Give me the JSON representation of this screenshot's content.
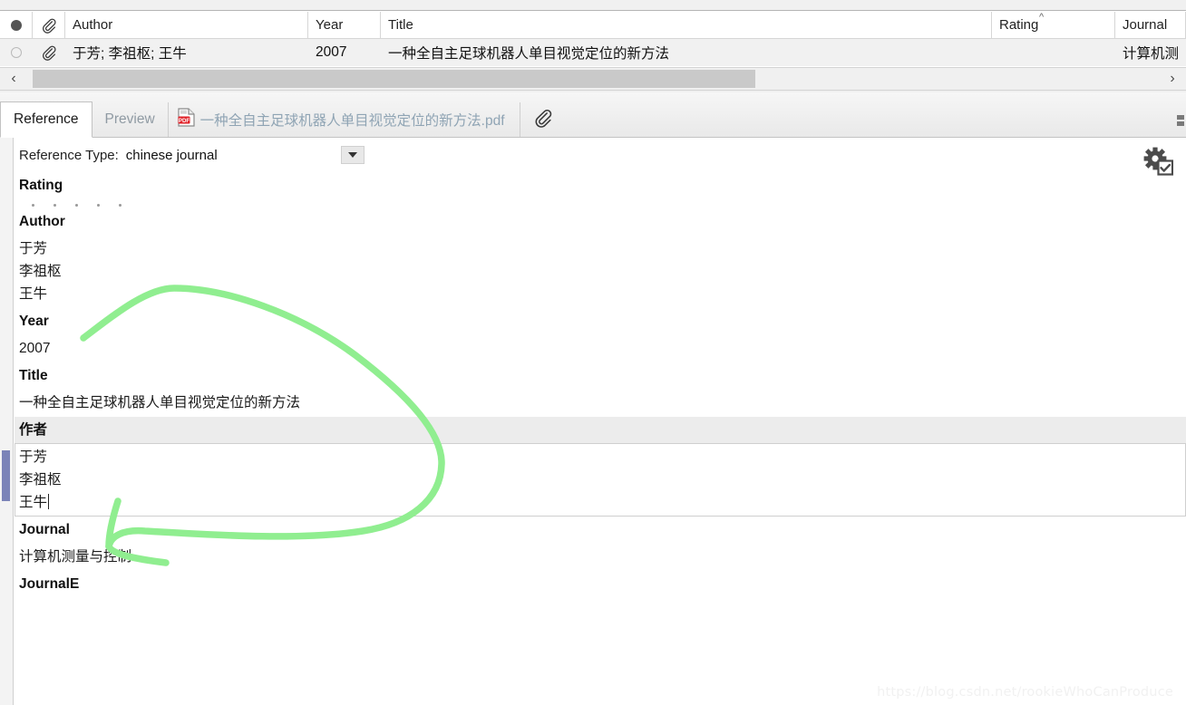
{
  "table": {
    "columns": [
      {
        "key": "read",
        "label": "",
        "icon": "read-status-dot-icon"
      },
      {
        "key": "attach",
        "label": "",
        "icon": "paperclip-icon"
      },
      {
        "key": "author",
        "label": "Author"
      },
      {
        "key": "year",
        "label": "Year"
      },
      {
        "key": "title",
        "label": "Title"
      },
      {
        "key": "rating",
        "label": "Rating",
        "sort": "ascending"
      },
      {
        "key": "journal",
        "label": "Journal"
      }
    ],
    "rows": [
      {
        "read": "unread",
        "attach": "paperclip-icon",
        "author": "于芳; 李祖枢; 王牛",
        "year": "2007",
        "title": "一种全自主足球机器人单目视觉定位的新方法",
        "rating": "",
        "journal": "计算机测"
      }
    ],
    "hscroll": {
      "left_arrow": "‹",
      "right_arrow": "›"
    }
  },
  "tabs": {
    "items": [
      {
        "label": "Reference",
        "state": "active"
      },
      {
        "label": "Preview",
        "state": "inactive"
      },
      {
        "label": "一种全自主足球机器人单目视觉定位的新方法.pdf",
        "state": "inactive",
        "icon": "pdf-file-icon"
      }
    ],
    "attach_icon": "paperclip-icon"
  },
  "detail": {
    "reference_type": {
      "label": "Reference Type:",
      "value": "chinese journal",
      "dropdown_icon": "chevron-down-icon"
    },
    "settings_icon": "gear-checkbox-icon",
    "fields": [
      {
        "name": "Rating",
        "type": "rating",
        "dots": 5,
        "value": ""
      },
      {
        "name": "Author",
        "type": "multiline",
        "lines": [
          "于芳",
          "李祖枢",
          "王牛"
        ]
      },
      {
        "name": "Year",
        "type": "text",
        "lines": [
          "2007"
        ]
      },
      {
        "name": "Title",
        "type": "text",
        "lines": [
          "一种全自主足球机器人单目视觉定位的新方法"
        ]
      },
      {
        "name": "作者",
        "type": "multiline",
        "lines": [
          "于芳",
          "李祖枢",
          "王牛"
        ],
        "state": "focused"
      },
      {
        "name": "Journal",
        "type": "text",
        "lines": [
          "计算机测量与控制"
        ]
      },
      {
        "name": "JournalE",
        "type": "text",
        "lines": [
          ""
        ]
      }
    ]
  },
  "annotation": {
    "color": "#90ee90",
    "shape": "hand-drawn-arrow-loop",
    "points_to": "作者"
  },
  "watermark": {
    "text": "https://blog.csdn.net/rookieWhoCanProduce"
  },
  "colors": {
    "row_bg": "#f1f1f1",
    "field_hl": "#ececec",
    "scroll_thumb": "#7b83b8",
    "annotation": "#90ee90",
    "pdf_red": "#e01f26"
  }
}
